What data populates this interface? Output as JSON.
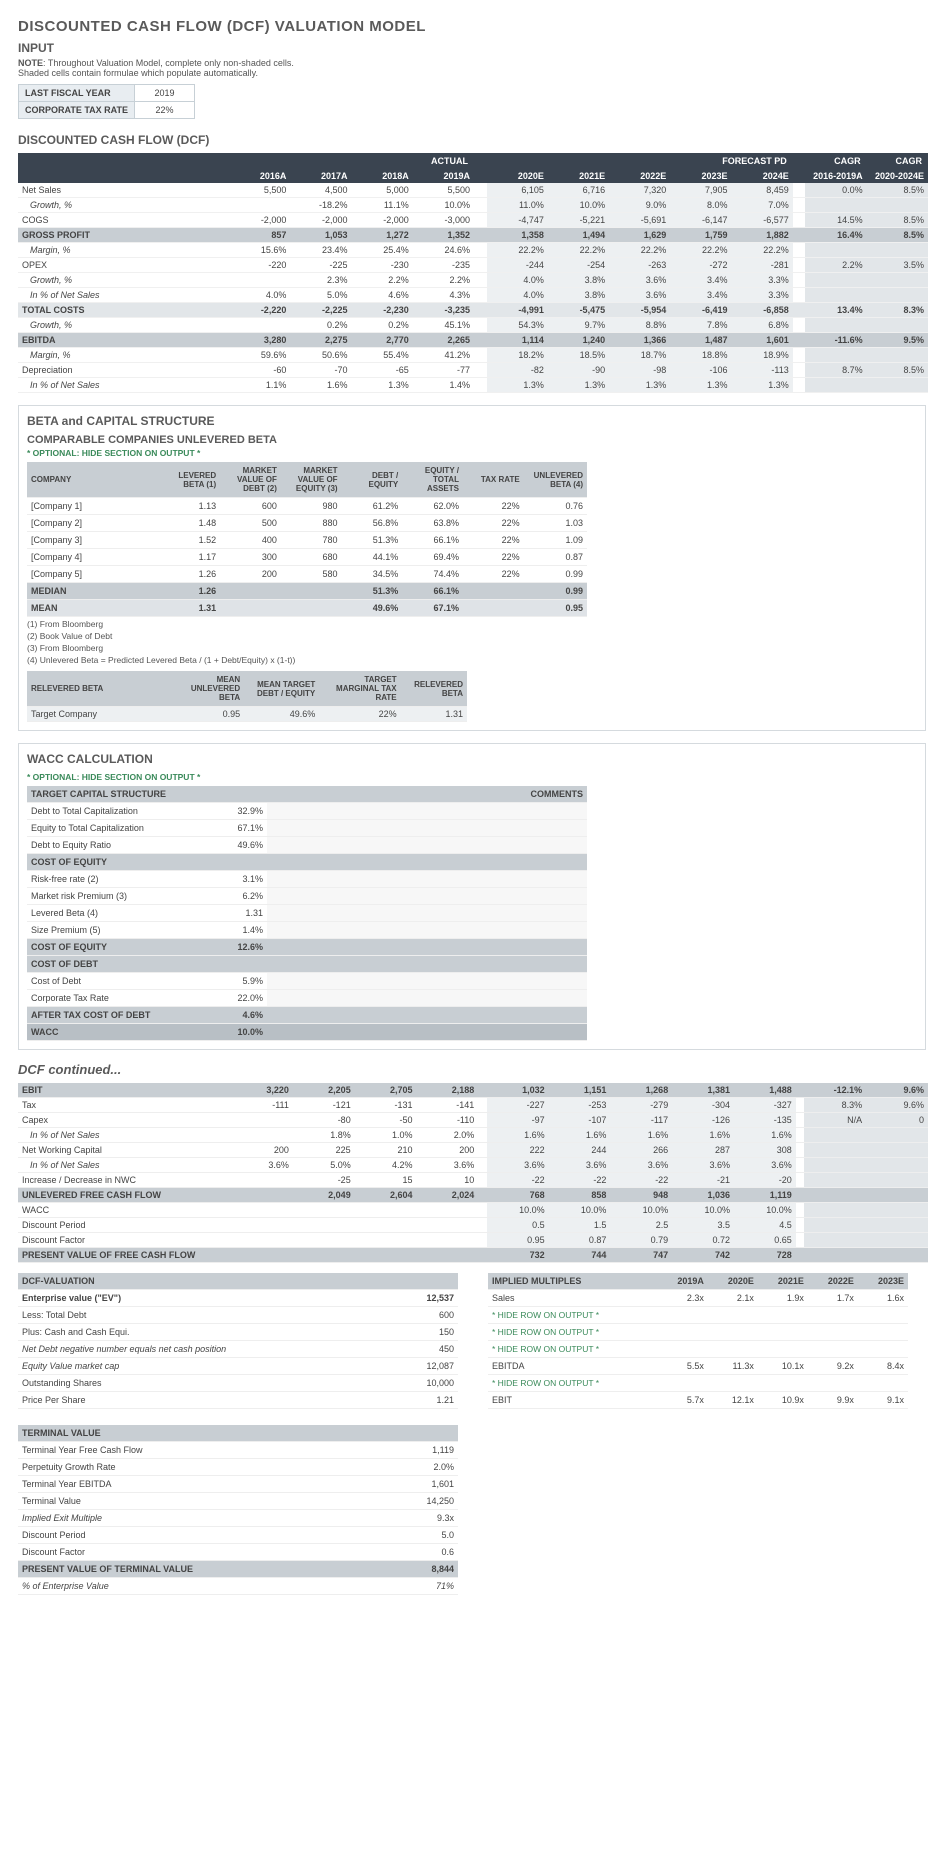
{
  "titles": {
    "main": "DISCOUNTED CASH FLOW (DCF) VALUATION MODEL",
    "input": "INPUT",
    "dcf": "DISCOUNTED CASH FLOW (DCF)",
    "beta": "BETA and CAPITAL STRUCTURE",
    "comp": "COMPARABLE COMPANIES UNLEVERED BETA",
    "wacc": "WACC CALCULATION",
    "cont": "DCF continued..."
  },
  "note": "NOTE: Throughout Valuation Model, complete only non-shaded cells. Shaded cells contain formulae which populate automatically.",
  "opt": "* OPTIONAL: HIDE SECTION ON OUTPUT *",
  "input": {
    "r1l": "LAST FISCAL YEAR",
    "r1v": "2019",
    "r2l": "CORPORATE TAX RATE",
    "r2v": "22%"
  },
  "dcf": {
    "h": {
      "actual": "ACTUAL",
      "fcst": "FORECAST PD",
      "cagr": "CAGR"
    },
    "yrs": [
      "2016A",
      "2017A",
      "2018A",
      "2019A",
      "2020E",
      "2021E",
      "2022E",
      "2023E",
      "2024E",
      "2016-2019A",
      "2020-2024E"
    ],
    "rows": [
      {
        "l": "Net Sales",
        "c": "",
        "a": [
          "5,500",
          "4,500",
          "5,000",
          "5,500"
        ],
        "f": [
          "6,105",
          "6,716",
          "7,320",
          "7,905",
          "8,459"
        ],
        "g": [
          "0.0%",
          "8.5%"
        ]
      },
      {
        "l": "Growth, %",
        "c": "it ind1",
        "a": [
          "",
          "-18.2%",
          "11.1%",
          "10.0%"
        ],
        "f": [
          "11.0%",
          "10.0%",
          "9.0%",
          "8.0%",
          "7.0%"
        ],
        "g": [
          "",
          ""
        ]
      },
      {
        "l": "COGS",
        "c": "",
        "a": [
          "-2,000",
          "-2,000",
          "-2,000",
          "-3,000"
        ],
        "f": [
          "-4,747",
          "-5,221",
          "-5,691",
          "-6,147",
          "-6,577"
        ],
        "g": [
          "14.5%",
          "8.5%"
        ]
      },
      {
        "l": "GROSS PROFIT",
        "c": "rw-bold",
        "a": [
          "857",
          "1,053",
          "1,272",
          "1,352"
        ],
        "f": [
          "1,358",
          "1,494",
          "1,629",
          "1,759",
          "1,882"
        ],
        "g": [
          "16.4%",
          "8.5%"
        ]
      },
      {
        "l": "Margin, %",
        "c": "it ind1",
        "a": [
          "15.6%",
          "23.4%",
          "25.4%",
          "24.6%"
        ],
        "f": [
          "22.2%",
          "22.2%",
          "22.2%",
          "22.2%",
          "22.2%"
        ],
        "g": [
          "",
          ""
        ]
      },
      {
        "l": "OPEX",
        "c": "",
        "a": [
          "-220",
          "-225",
          "-230",
          "-235"
        ],
        "f": [
          "-244",
          "-254",
          "-263",
          "-272",
          "-281"
        ],
        "g": [
          "2.2%",
          "3.5%"
        ]
      },
      {
        "l": "Growth, %",
        "c": "it ind1",
        "a": [
          "",
          "2.3%",
          "2.2%",
          "2.2%"
        ],
        "f": [
          "4.0%",
          "3.8%",
          "3.6%",
          "3.4%",
          "3.3%"
        ],
        "g": [
          "",
          ""
        ]
      },
      {
        "l": "In % of Net Sales",
        "c": "it ind1",
        "a": [
          "4.0%",
          "5.0%",
          "4.6%",
          "4.3%"
        ],
        "f": [
          "4.0%",
          "3.8%",
          "3.6%",
          "3.4%",
          "3.3%"
        ],
        "g": [
          "",
          ""
        ]
      },
      {
        "l": "TOTAL COSTS",
        "c": "rw-sub",
        "a": [
          "-2,220",
          "-2,225",
          "-2,230",
          "-3,235"
        ],
        "f": [
          "-4,991",
          "-5,475",
          "-5,954",
          "-6,419",
          "-6,858"
        ],
        "g": [
          "13.4%",
          "8.3%"
        ]
      },
      {
        "l": "Growth, %",
        "c": "it ind1",
        "a": [
          "",
          "0.2%",
          "0.2%",
          "45.1%"
        ],
        "f": [
          "54.3%",
          "9.7%",
          "8.8%",
          "7.8%",
          "6.8%"
        ],
        "g": [
          "",
          ""
        ]
      },
      {
        "l": "EBITDA",
        "c": "rw-bold",
        "a": [
          "3,280",
          "2,275",
          "2,770",
          "2,265"
        ],
        "f": [
          "1,114",
          "1,240",
          "1,366",
          "1,487",
          "1,601"
        ],
        "g": [
          "-11.6%",
          "9.5%"
        ]
      },
      {
        "l": "Margin, %",
        "c": "it ind1",
        "a": [
          "59.6%",
          "50.6%",
          "55.4%",
          "41.2%"
        ],
        "f": [
          "18.2%",
          "18.5%",
          "18.7%",
          "18.8%",
          "18.9%"
        ],
        "g": [
          "",
          ""
        ]
      },
      {
        "l": "Depreciation",
        "c": "",
        "a": [
          "-60",
          "-70",
          "-65",
          "-77"
        ],
        "f": [
          "-82",
          "-90",
          "-98",
          "-106",
          "-113"
        ],
        "g": [
          "8.7%",
          "8.5%"
        ]
      },
      {
        "l": "In % of Net Sales",
        "c": "it ind1",
        "a": [
          "1.1%",
          "1.6%",
          "1.3%",
          "1.4%"
        ],
        "f": [
          "1.3%",
          "1.3%",
          "1.3%",
          "1.3%",
          "1.3%"
        ],
        "g": [
          "",
          ""
        ]
      }
    ]
  },
  "beta": {
    "hdr": [
      "COMPANY",
      "LEVERED BETA (1)",
      "MARKET VALUE OF DEBT (2)",
      "MARKET VALUE OF EQUITY (3)",
      "DEBT / EQUITY",
      "EQUITY / TOTAL ASSETS",
      "TAX RATE",
      "UNLEVERED BETA (4)"
    ],
    "rows": [
      [
        "[Company 1]",
        "1.13",
        "600",
        "980",
        "61.2%",
        "62.0%",
        "22%",
        "0.76"
      ],
      [
        "[Company 2]",
        "1.48",
        "500",
        "880",
        "56.8%",
        "63.8%",
        "22%",
        "1.03"
      ],
      [
        "[Company 3]",
        "1.52",
        "400",
        "780",
        "51.3%",
        "66.1%",
        "22%",
        "1.09"
      ],
      [
        "[Company 4]",
        "1.17",
        "300",
        "680",
        "44.1%",
        "69.4%",
        "22%",
        "0.87"
      ],
      [
        "[Company 5]",
        "1.26",
        "200",
        "580",
        "34.5%",
        "74.4%",
        "22%",
        "0.99"
      ]
    ],
    "median": [
      "MEDIAN",
      "1.26",
      "",
      "",
      "51.3%",
      "66.1%",
      "",
      "0.99"
    ],
    "mean": [
      "MEAN",
      "1.31",
      "",
      "",
      "49.6%",
      "67.1%",
      "",
      "0.95"
    ],
    "foot": [
      "(1) From Bloomberg",
      "(2) Book Value of Debt",
      "(3) From Bloomberg",
      "(4) Unlevered Beta = Predicted Levered Beta / (1 + Debt/Equity) x (1-t))"
    ]
  },
  "relev": {
    "hdr": [
      "RELEVERED BETA",
      "MEAN UNLEVERED BETA",
      "MEAN TARGET DEBT / EQUITY",
      "TARGET MARGINAL TAX RATE",
      "RELEVERED BETA"
    ],
    "row": [
      "Target Company",
      "0.95",
      "49.6%",
      "22%",
      "1.31"
    ]
  },
  "wacc": {
    "comments": "COMMENTS",
    "sec": [
      {
        "h": "TARGET CAPITAL STRUCTURE",
        "r": [
          [
            "Debt to Total Capitalization",
            "32.9%"
          ],
          [
            "Equity to Total Capitalization",
            "67.1%"
          ],
          [
            "Debt to Equity Ratio",
            "49.6%"
          ]
        ]
      },
      {
        "h": "COST OF EQUITY",
        "r": [
          [
            "Risk-free rate (2)",
            "3.1%"
          ],
          [
            "Market risk Premium (3)",
            "6.2%"
          ],
          [
            "Levered Beta (4)",
            "1.31"
          ],
          [
            "Size Premium (5)",
            "1.4%"
          ]
        ],
        "t": [
          "COST OF EQUITY",
          "12.6%"
        ]
      },
      {
        "h": "COST OF DEBT",
        "r": [
          [
            "Cost of Debt",
            "5.9%"
          ],
          [
            "Corporate Tax Rate",
            "22.0%"
          ]
        ],
        "t": [
          "AFTER TAX COST OF DEBT",
          "4.6%"
        ]
      }
    ],
    "final": [
      "WACC",
      "10.0%"
    ]
  },
  "dcf2": {
    "rows": [
      {
        "l": "EBIT",
        "c": "sh",
        "a": [
          "3,220",
          "2,205",
          "2,705",
          "2,188"
        ],
        "f": [
          "1,032",
          "1,151",
          "1,268",
          "1,381",
          "1,488"
        ],
        "g": [
          "-12.1%",
          "9.6%"
        ]
      },
      {
        "l": "Tax",
        "c": "",
        "a": [
          "-111",
          "-121",
          "-131",
          "-141"
        ],
        "f": [
          "-227",
          "-253",
          "-279",
          "-304",
          "-327"
        ],
        "g": [
          "8.3%",
          "9.6%"
        ]
      },
      {
        "l": "Capex",
        "c": "",
        "a": [
          "",
          "-80",
          "-50",
          "-110"
        ],
        "f": [
          "-97",
          "-107",
          "-117",
          "-126",
          "-135"
        ],
        "g": [
          "N/A",
          "0"
        ]
      },
      {
        "l": "In % of Net Sales",
        "c": "it ind1",
        "a": [
          "",
          "1.8%",
          "1.0%",
          "2.0%"
        ],
        "f": [
          "1.6%",
          "1.6%",
          "1.6%",
          "1.6%",
          "1.6%"
        ],
        "g": [
          "",
          ""
        ]
      },
      {
        "l": "Net Working Capital",
        "c": "",
        "a": [
          "200",
          "225",
          "210",
          "200"
        ],
        "f": [
          "222",
          "244",
          "266",
          "287",
          "308"
        ],
        "g": [
          "",
          ""
        ]
      },
      {
        "l": "In % of Net Sales",
        "c": "it ind1",
        "a": [
          "3.6%",
          "5.0%",
          "4.2%",
          "3.6%"
        ],
        "f": [
          "3.6%",
          "3.6%",
          "3.6%",
          "3.6%",
          "3.6%"
        ],
        "g": [
          "",
          ""
        ]
      },
      {
        "l": "Increase / Decrease in NWC",
        "c": "",
        "a": [
          "",
          "-25",
          "15",
          "10"
        ],
        "f": [
          "-22",
          "-22",
          "-22",
          "-21",
          "-20"
        ],
        "g": [
          "",
          ""
        ]
      },
      {
        "l": "UNLEVERED FREE CASH FLOW",
        "c": "sh",
        "a": [
          "",
          "2,049",
          "2,604",
          "2,024"
        ],
        "f": [
          "768",
          "858",
          "948",
          "1,036",
          "1,119"
        ],
        "g": [
          "",
          ""
        ]
      },
      {
        "l": "WACC",
        "c": "",
        "a": [
          "",
          "",
          "",
          ""
        ],
        "f": [
          "10.0%",
          "10.0%",
          "10.0%",
          "10.0%",
          "10.0%"
        ],
        "g": [
          "",
          ""
        ]
      },
      {
        "l": "Discount Period",
        "c": "",
        "a": [
          "",
          "",
          "",
          ""
        ],
        "f": [
          "0.5",
          "1.5",
          "2.5",
          "3.5",
          "4.5"
        ],
        "g": [
          "",
          ""
        ]
      },
      {
        "l": "Discount Factor",
        "c": "",
        "a": [
          "",
          "",
          "",
          ""
        ],
        "f": [
          "0.95",
          "0.87",
          "0.79",
          "0.72",
          "0.65"
        ],
        "g": [
          "",
          ""
        ]
      },
      {
        "l": "PRESENT VALUE OF FREE CASH FLOW",
        "c": "sh",
        "a": [
          "",
          "",
          "",
          ""
        ],
        "f": [
          "732",
          "744",
          "747",
          "742",
          "728"
        ],
        "g": [
          "",
          ""
        ]
      }
    ]
  },
  "val": {
    "h": "DCF-VALUATION",
    "r": [
      [
        "Enterprise value (\"EV\")",
        "12,537",
        "b"
      ],
      [
        "Less: Total Debt",
        "600",
        "ind1"
      ],
      [
        "Plus: Cash and Cash Equi.",
        "150",
        "ind1"
      ],
      [
        "Net Debt  negative number equals net cash position",
        "450",
        "ind1 it"
      ],
      [
        "Equity Value  market cap",
        "12,087",
        "it"
      ],
      [
        "Outstanding Shares",
        "10,000",
        "ind1"
      ],
      [
        "Price Per Share",
        "1.21",
        ""
      ]
    ]
  },
  "im": {
    "h": "IMPLIED MULTIPLES",
    "yrs": [
      "2019A",
      "2020E",
      "2021E",
      "2022E",
      "2023E"
    ],
    "r": [
      [
        "Sales",
        "2.3x",
        "2.1x",
        "1.9x",
        "1.7x",
        "1.6x"
      ],
      [
        "* HIDE ROW ON OUTPUT *",
        "",
        "",
        "",
        "",
        ""
      ],
      [
        "* HIDE ROW ON OUTPUT *",
        "",
        "",
        "",
        "",
        ""
      ],
      [
        "* HIDE ROW ON OUTPUT *",
        "",
        "",
        "",
        "",
        ""
      ],
      [
        "EBITDA",
        "5.5x",
        "11.3x",
        "10.1x",
        "9.2x",
        "8.4x"
      ],
      [
        "* HIDE ROW ON OUTPUT *",
        "",
        "",
        "",
        "",
        ""
      ],
      [
        "EBIT",
        "5.7x",
        "12.1x",
        "10.9x",
        "9.9x",
        "9.1x"
      ]
    ]
  },
  "term": {
    "h": "TERMINAL VALUE",
    "r": [
      [
        "Terminal Year Free Cash Flow",
        "1,119"
      ],
      [
        "Perpetuity Growth Rate",
        "2.0%"
      ],
      [
        "Terminal Year EBITDA",
        "1,601"
      ],
      [
        "Terminal Value",
        "14,250"
      ],
      [
        "Implied Exit Multiple",
        "9.3x",
        "it ind1"
      ],
      [
        "Discount Period",
        "5.0"
      ],
      [
        "Discount Factor",
        "0.6"
      ]
    ],
    "t": [
      "PRESENT VALUE OF TERMINAL VALUE",
      "8,844"
    ],
    "pv": [
      "% of Enterprise Value",
      "71%",
      "it ind1"
    ]
  }
}
